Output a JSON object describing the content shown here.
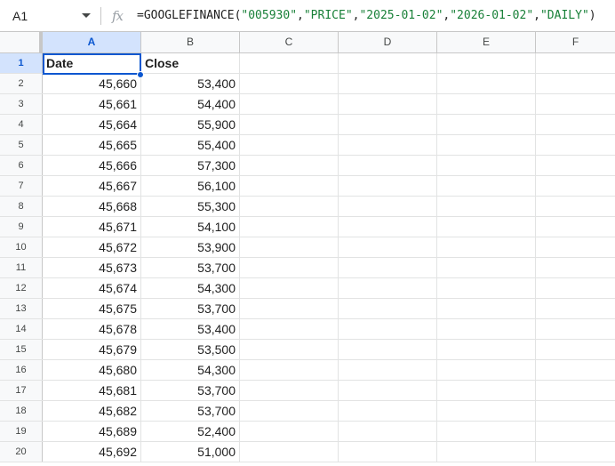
{
  "formula_bar": {
    "cell_ref": "A1",
    "fx_label": "fx",
    "formula_parts": [
      {
        "text": "=GOOGLEFINANCE(",
        "type": "fn"
      },
      {
        "text": "\"005930\"",
        "type": "str"
      },
      {
        "text": ",",
        "type": "fn"
      },
      {
        "text": "\"PRICE\"",
        "type": "str"
      },
      {
        "text": ",",
        "type": "fn"
      },
      {
        "text": "\"2025-01-02\"",
        "type": "str"
      },
      {
        "text": ",",
        "type": "fn"
      },
      {
        "text": "\"2026-01-02\"",
        "type": "str"
      },
      {
        "text": ",",
        "type": "fn"
      },
      {
        "text": "\"DAILY\"",
        "type": "str"
      },
      {
        "text": ")",
        "type": "fn"
      }
    ]
  },
  "columns": [
    "A",
    "B",
    "C",
    "D",
    "E",
    "F"
  ],
  "selected_cell": "A1",
  "rows": [
    {
      "n": "1",
      "a": "Date",
      "b": "Close"
    },
    {
      "n": "2",
      "a": "45,660",
      "b": "53,400"
    },
    {
      "n": "3",
      "a": "45,661",
      "b": "54,400"
    },
    {
      "n": "4",
      "a": "45,664",
      "b": "55,900"
    },
    {
      "n": "5",
      "a": "45,665",
      "b": "55,400"
    },
    {
      "n": "6",
      "a": "45,666",
      "b": "57,300"
    },
    {
      "n": "7",
      "a": "45,667",
      "b": "56,100"
    },
    {
      "n": "8",
      "a": "45,668",
      "b": "55,300"
    },
    {
      "n": "9",
      "a": "45,671",
      "b": "54,100"
    },
    {
      "n": "10",
      "a": "45,672",
      "b": "53,900"
    },
    {
      "n": "11",
      "a": "45,673",
      "b": "53,700"
    },
    {
      "n": "12",
      "a": "45,674",
      "b": "54,300"
    },
    {
      "n": "13",
      "a": "45,675",
      "b": "53,700"
    },
    {
      "n": "14",
      "a": "45,678",
      "b": "53,400"
    },
    {
      "n": "15",
      "a": "45,679",
      "b": "53,500"
    },
    {
      "n": "16",
      "a": "45,680",
      "b": "54,300"
    },
    {
      "n": "17",
      "a": "45,681",
      "b": "53,700"
    },
    {
      "n": "18",
      "a": "45,682",
      "b": "53,700"
    },
    {
      "n": "19",
      "a": "45,689",
      "b": "52,400"
    },
    {
      "n": "20",
      "a": "45,692",
      "b": "51,000"
    }
  ],
  "colors": {
    "selection": "#0b57d0",
    "header_selected_bg": "#d3e3fd",
    "formula_string": "#188038"
  }
}
